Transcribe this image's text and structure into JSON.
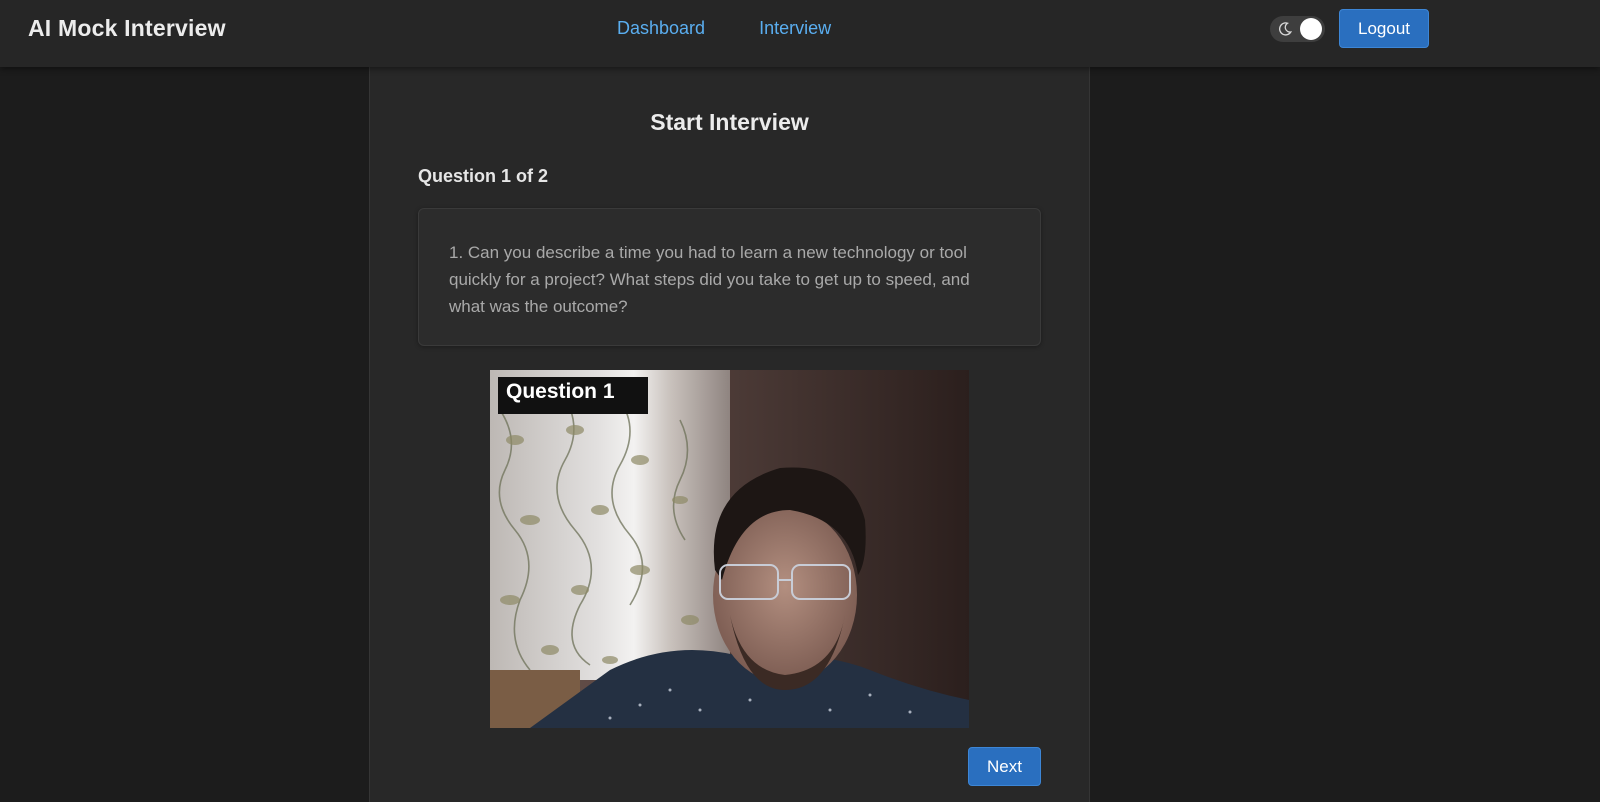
{
  "header": {
    "brand": "AI Mock Interview",
    "nav": [
      {
        "label": "Dashboard"
      },
      {
        "label": "Interview"
      }
    ],
    "theme_toggle": {
      "icon": "moon-icon",
      "state": "dark"
    },
    "logout_label": "Logout"
  },
  "interview": {
    "title": "Start Interview",
    "counter": "Question 1 of 2",
    "question_text": "1. Can you describe a time you had to learn a new technology or tool quickly for a project? What steps did you take to get up to speed, and what was the outcome?",
    "video_overlay_label": "Question 1",
    "next_label": "Next"
  },
  "colors": {
    "accent": "#2a6fbf",
    "link": "#5aaef0",
    "background": "#1c1c1c",
    "panel": "#282828"
  }
}
